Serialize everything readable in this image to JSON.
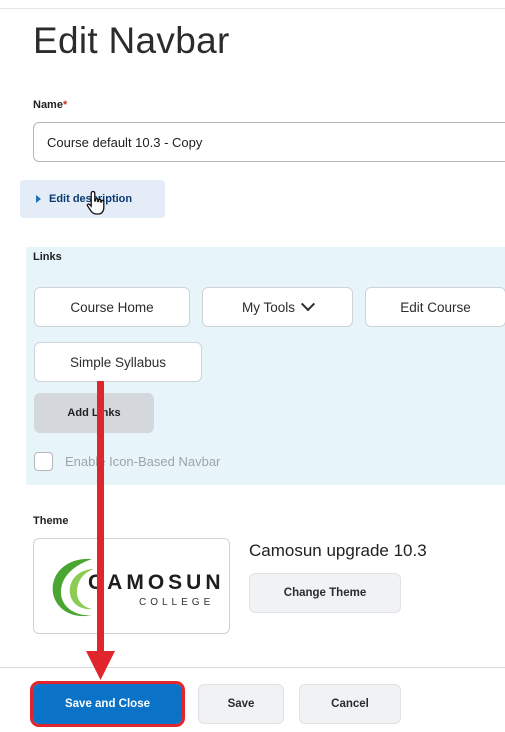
{
  "page": {
    "title": "Edit Navbar"
  },
  "name_field": {
    "label": "Name",
    "required_marker": "*",
    "value": "Course default 10.3 - Copy"
  },
  "description": {
    "toggle_label": "Edit description"
  },
  "links": {
    "label": "Links",
    "items": [
      {
        "label": "Course Home"
      },
      {
        "label": "My Tools",
        "has_dropdown": true
      },
      {
        "label": "Edit Course"
      },
      {
        "label": "Simple Syllabus"
      }
    ],
    "add_button_label": "Add Links",
    "icon_navbar_checkbox_label": "Enable Icon-Based Navbar",
    "icon_navbar_checked": false
  },
  "theme": {
    "label": "Theme",
    "name": "Camosun upgrade 10.3",
    "logo_text_line1": "CAMOSUN",
    "logo_text_line2": "COLLEGE",
    "change_button_label": "Change Theme"
  },
  "footer": {
    "save_close_label": "Save and Close",
    "save_label": "Save",
    "cancel_label": "Cancel"
  },
  "colors": {
    "primary": "#0a72c7",
    "links_panel_bg": "#e7f5fb",
    "annotation_red": "#e0262c",
    "logo_green": "#5bb431"
  },
  "icons": {
    "cursor": "hand-pointer-icon",
    "expand": "triangle-right-icon",
    "dropdown": "chevron-down-icon"
  }
}
